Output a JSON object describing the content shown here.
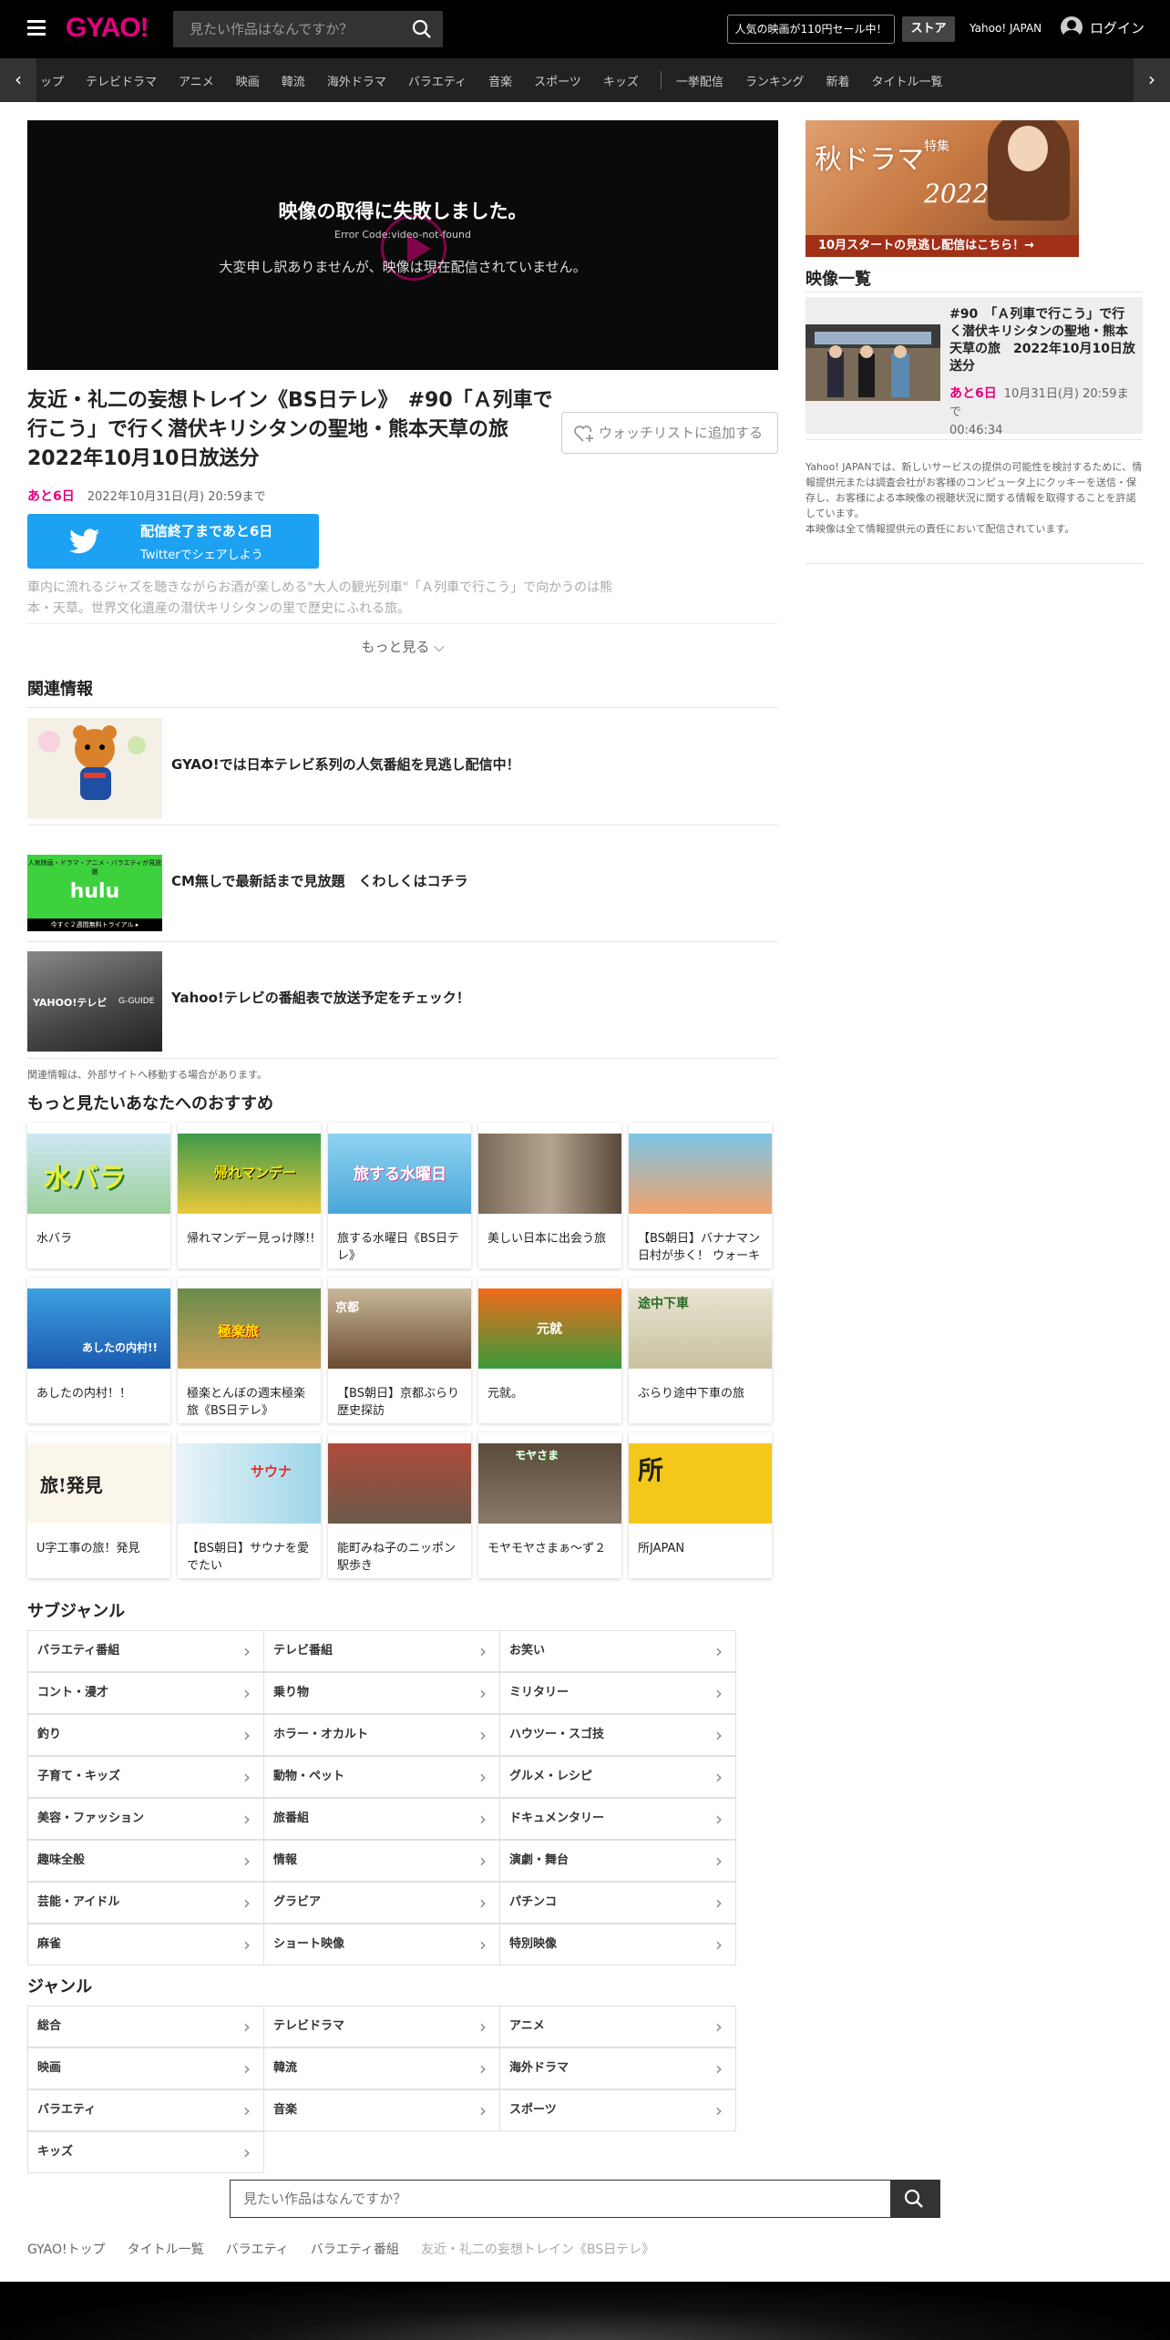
{
  "header": {
    "logo": "GYAO!",
    "search_placeholder": "見たい作品はなんですか？",
    "sale": "人気の映画が110円セール中！",
    "store": "ストア",
    "yahoo": "Yahoo! JAPAN",
    "login": "ログイン"
  },
  "nav": {
    "items": [
      "ップ",
      "テレビドラマ",
      "アニメ",
      "映画",
      "韓流",
      "海外ドラマ",
      "バラエティ",
      "音楽",
      "スポーツ",
      "キッズ",
      "一挙配信",
      "ランキング",
      "新着",
      "タイトル一覧"
    ],
    "prev": "‹",
    "next": "›"
  },
  "player": {
    "error_title": "映像の取得に失敗しました。",
    "error_code": "Error Code:video-not-found",
    "error_message": "大変申し訳ありませんが、映像は現在配信されていません。"
  },
  "episode": {
    "title": "友近・礼二の妄想トレイン《BS日テレ》　#90「Ａ列車で行こう」で行く潜伏キリシタンの聖地・熊本天草の旅　2022年10月10日放送分",
    "watchlist": "ウォッチリストに追加する",
    "remaining": "あと6日",
    "end_date": "2022年10月31日(月) 20:59まで",
    "twitter_line1": "配信終了まであと6日",
    "twitter_line2": "Twitterでシェアしよう",
    "description": "車内に流れるジャズを聴きながらお酒が楽しめる\"大人の観光列車\"「Ａ列車で行こう」で向かうのは熊本・天草。世界文化遺産の潜伏キリシタンの里で歴史にふれる旅。",
    "more": "もっと見る"
  },
  "related": {
    "heading": "関連情報",
    "items": [
      {
        "text": "GYAO!では日本テレビ系列の人気番組を見逃し配信中！"
      },
      {
        "text": "CM無しで最新話まで見放題　くわしくはコチラ",
        "thumb_top": "人気映画・ドラマ・アニメ・バラエティが見放題",
        "thumb_logo": "hulu",
        "thumb_bottom": "今すぐ２週間無料トライアル ▸"
      },
      {
        "text": "Yahoo!テレビの番組表で放送予定をチェック！",
        "thumb_logo": "YAHOO!テレビ",
        "thumb_sub": "G-GUIDE"
      }
    ],
    "note": "関連情報は、外部サイトへ移動する場合があります。"
  },
  "recommend": {
    "heading": "もっと見たいあなたへのおすすめ",
    "items": [
      {
        "title": "水バラ",
        "thumb": "水バラ"
      },
      {
        "title": "帰れマンデー見っけ隊!!",
        "thumb": "帰れマンデー"
      },
      {
        "title": "旅する水曜日《BS日テレ》",
        "thumb": "旅する水曜日"
      },
      {
        "title": "美しい日本に出会う旅",
        "thumb": ""
      },
      {
        "title": "【BS朝日】バナナマン日村が歩く！ ウォーキ",
        "thumb": ""
      },
      {
        "title": "あしたの内村！！",
        "thumb": "あしたの内村!!"
      },
      {
        "title": "極楽とんぼの週末極楽旅《BS日テレ》",
        "thumb": "極楽旅"
      },
      {
        "title": "【BS朝日】京都ぶらり歴史探訪",
        "thumb": "京都"
      },
      {
        "title": "元就。",
        "thumb": "元就"
      },
      {
        "title": "ぶらり途中下車の旅",
        "thumb": "途中下車"
      },
      {
        "title": "U字工事の旅！発見",
        "thumb": "旅!発見"
      },
      {
        "title": "【BS朝日】サウナを愛でたい",
        "thumb": "サウナ"
      },
      {
        "title": "能町みね子のニッポン駅歩き",
        "thumb": ""
      },
      {
        "title": "モヤモヤさまぁ～ず２",
        "thumb": "モヤさま"
      },
      {
        "title": "所JAPAN",
        "thumb": "所"
      }
    ]
  },
  "subgenre": {
    "heading": "サブジャンル",
    "items": [
      "バラエティ番組",
      "テレビ番組",
      "お笑い",
      "コント・漫才",
      "乗り物",
      "ミリタリー",
      "釣り",
      "ホラー・オカルト",
      "ハウツー・スゴ技",
      "子育て・キッズ",
      "動物・ペット",
      "グルメ・レシピ",
      "美容・ファッション",
      "旅番組",
      "ドキュメンタリー",
      "趣味全般",
      "情報",
      "演劇・舞台",
      "芸能・アイドル",
      "グラビア",
      "パチンコ",
      "麻雀",
      "ショート映像",
      "特別映像"
    ]
  },
  "genre": {
    "heading": "ジャンル",
    "items": [
      "総合",
      "テレビドラマ",
      "アニメ",
      "映画",
      "韓流",
      "海外ドラマ",
      "バラエティ",
      "音楽",
      "スポーツ",
      "キッズ"
    ]
  },
  "bottom_search": {
    "placeholder": "見たい作品はなんですか？"
  },
  "breadcrumb": [
    "GYAO!トップ",
    "タイトル一覧",
    "バラエティ",
    "バラエティ番組",
    "友近・礼二の妄想トレイン《BS日テレ》"
  ],
  "sidebar": {
    "banner_title": "秋ドラマ",
    "banner_special": "特集",
    "banner_year": "2022",
    "banner_caption": "10月スタートの見逃し配信はこちら！→",
    "list_heading": "映像一覧",
    "video_title": "#90　「Ａ列車で行こう」で行く潜伏キリシタンの聖地・熊本天草の旅　2022年10月10日放送分",
    "video_remaining": "あと6日",
    "video_date": "10月31日(月) 20:59まで",
    "video_duration": "00:46:34",
    "legal": "Yahoo! JAPANでは、新しいサービスの提供の可能性を検討するために、情報提供元または調査会社がお客様のコンピュータ上にクッキーを送信・保存し、お客様による本映像の視聴状況に関する情報を取得することを許諾しています。\n本映像は全て情報提供元の責任において配信されています。"
  },
  "colors": {
    "brand": "#e4007f",
    "twitter": "#1da1f2",
    "header": "#000000"
  }
}
